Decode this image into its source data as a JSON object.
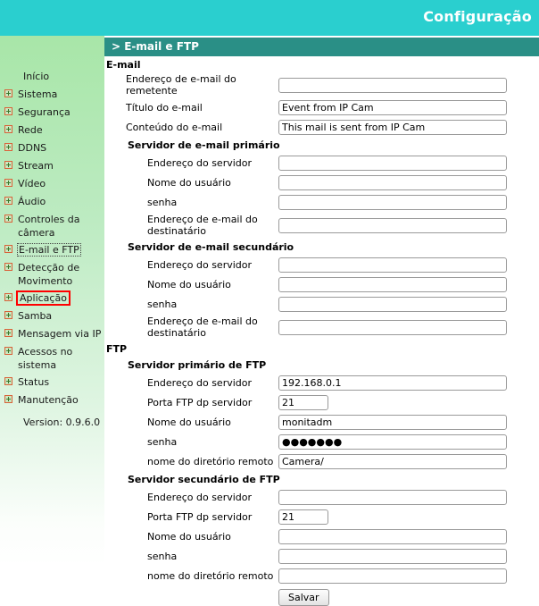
{
  "header": {
    "title": "Configuração",
    "banner_color": "#2ACFCF"
  },
  "breadcrumb": {
    "text": "> E-mail e FTP",
    "bar_color": "#2A8F86"
  },
  "sidebar": {
    "version_label": "Version: 0.9.6.0",
    "focused_item": "E-mail e FTP",
    "annotated_item": "Aplicação",
    "annotation_color": "#FF0000",
    "items": [
      {
        "label": "Início",
        "icon": "",
        "expandable": false
      },
      {
        "label": "Sistema",
        "icon": "plus-box-icon",
        "expandable": true
      },
      {
        "label": "Segurança",
        "icon": "plus-box-icon",
        "expandable": true
      },
      {
        "label": "Rede",
        "icon": "plus-box-icon",
        "expandable": true
      },
      {
        "label": "DDNS",
        "icon": "plus-box-icon",
        "expandable": true
      },
      {
        "label": "Stream",
        "icon": "plus-box-icon",
        "expandable": true
      },
      {
        "label": "Vídeo",
        "icon": "plus-box-icon",
        "expandable": true
      },
      {
        "label": "Áudio",
        "icon": "plus-box-icon",
        "expandable": true
      },
      {
        "label": "Controles da câmera",
        "icon": "plus-box-icon",
        "expandable": true
      },
      {
        "label": "E-mail e FTP",
        "icon": "plus-box-icon",
        "expandable": true
      },
      {
        "label": "Detecção de Movimento",
        "icon": "plus-box-icon",
        "expandable": true
      },
      {
        "label": "Aplicação",
        "icon": "plus-box-icon",
        "expandable": true
      },
      {
        "label": "Samba",
        "icon": "plus-box-icon",
        "expandable": true
      },
      {
        "label": "Mensagem via IP",
        "icon": "plus-box-icon",
        "expandable": true
      },
      {
        "label": "Acessos no sistema",
        "icon": "plus-box-icon",
        "expandable": true
      },
      {
        "label": "Status",
        "icon": "plus-box-icon",
        "expandable": true
      },
      {
        "label": "Manutenção",
        "icon": "plus-box-icon",
        "expandable": true
      }
    ]
  },
  "email_section": {
    "title": "E-mail",
    "fields": [
      {
        "label": "Endereço de e-mail do remetente",
        "value": ""
      },
      {
        "label": "Título do e-mail",
        "value": "Event from IP Cam"
      },
      {
        "label": "Conteúdo do e-mail",
        "value": "This mail is sent from IP Cam"
      }
    ],
    "primary_server": {
      "title": "Servidor de e-mail primário",
      "fields": [
        {
          "label": "Endereço do servidor",
          "value": ""
        },
        {
          "label": "Nome do usuário",
          "value": ""
        },
        {
          "label": "senha",
          "value": ""
        },
        {
          "label": "Endereço de e-mail do destinatário",
          "value": ""
        }
      ]
    },
    "secondary_server": {
      "title": "Servidor de e-mail secundário",
      "fields": [
        {
          "label": "Endereço do servidor",
          "value": ""
        },
        {
          "label": "Nome do usuário",
          "value": ""
        },
        {
          "label": "senha",
          "value": ""
        },
        {
          "label": "Endereço de e-mail do destinatário",
          "value": ""
        }
      ]
    }
  },
  "ftp_section": {
    "title": "FTP",
    "primary_server": {
      "title": "Servidor primário de FTP",
      "fields": [
        {
          "label": "Endereço do servidor",
          "value": "192.168.0.1",
          "size": "wide"
        },
        {
          "label": "Porta FTP dp servidor",
          "value": "21",
          "size": "small"
        },
        {
          "label": "Nome do usuário",
          "value": "monitadm",
          "size": "wide"
        },
        {
          "label": "senha",
          "value": "●●●●●●●",
          "size": "wide"
        },
        {
          "label": "nome do diretório remoto",
          "value": "Camera/",
          "size": "wide"
        }
      ]
    },
    "secondary_server": {
      "title": "Servidor secundário de FTP",
      "fields": [
        {
          "label": "Endereço do servidor",
          "value": "",
          "size": "wide"
        },
        {
          "label": "Porta FTP dp servidor",
          "value": "21",
          "size": "small"
        },
        {
          "label": "Nome do usuário",
          "value": "",
          "size": "wide"
        },
        {
          "label": "senha",
          "value": "",
          "size": "wide"
        },
        {
          "label": "nome do diretório remoto",
          "value": "",
          "size": "wide"
        }
      ]
    }
  },
  "actions": {
    "save_label": "Salvar"
  }
}
